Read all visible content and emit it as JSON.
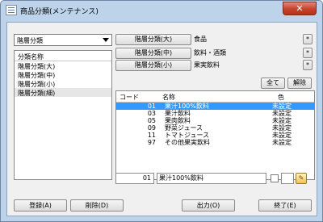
{
  "window": {
    "title": "商品分類(メンテナンス)",
    "close_glyph": "✕"
  },
  "combo": {
    "value": "階層分類"
  },
  "levels": {
    "header": "分類名称",
    "items": [
      "階層分類(大)",
      "階層分類(中)",
      "階層分類(小)",
      "階層分類(細)"
    ]
  },
  "level_buttons": [
    {
      "label": "階層分類(大)",
      "value": "食品"
    },
    {
      "label": "階層分類(中)",
      "value": "飲料・酒類"
    },
    {
      "label": "階層分類(小)",
      "value": "果実飲料"
    }
  ],
  "star_label": "*",
  "select_all_label": "全て",
  "deselect_label": "解除",
  "table": {
    "headers": {
      "code": "コード",
      "name": "名称",
      "color": "色"
    },
    "rows": [
      {
        "code": "01",
        "name": "果汁100%飲料",
        "color": "未設定"
      },
      {
        "code": "03",
        "name": "果汁飲料",
        "color": "未設定"
      },
      {
        "code": "05",
        "name": "果肉飲料",
        "color": "未設定"
      },
      {
        "code": "09",
        "name": "野菜ジュース",
        "color": "未設定"
      },
      {
        "code": "11",
        "name": "トマトジュース",
        "color": "未設定"
      },
      {
        "code": "97",
        "name": "その他果実飲料",
        "color": "未設定"
      }
    ]
  },
  "edit": {
    "code": "01",
    "name": "果汁100%飲料"
  },
  "footer": {
    "register": "登録(A)",
    "delete": "削除(D)",
    "output": "出力(O)",
    "exit": "終了(E)"
  },
  "colors": {
    "selection": "#3399ff",
    "frame": "#bcd3ea",
    "close": "#c7422a"
  }
}
